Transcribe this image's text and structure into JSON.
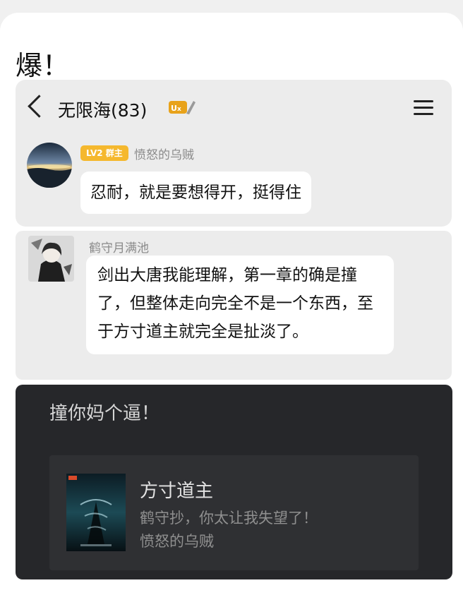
{
  "post": {
    "title": "爆！"
  },
  "chat": {
    "header": {
      "title": "无限海(83)",
      "badge": "vip-badge"
    },
    "messages": [
      {
        "role_badge": "LV2 群主",
        "sender": "愤怒的乌贼",
        "text": "忍耐，就是要想得开，挺得住"
      },
      {
        "sender": "鹤守月满池",
        "text": "剑出大唐我能理解，第一章的确是撞了，但整体走向完全不是一个东西，至于方寸道主就完全是扯淡了。"
      }
    ]
  },
  "reply": {
    "text": "撞你妈个逼！",
    "book": {
      "title": "方寸道主",
      "subtitle": "鹤守抄，你太让我失望了！",
      "author": "愤怒的乌贼"
    }
  },
  "colors": {
    "page_bg": "#ffffff",
    "chat_panel_bg": "#ececec",
    "bubble_bg": "#ffffff",
    "role_badge_bg": "#f5b82e",
    "dark_panel_bg": "#26272a",
    "book_card_bg": "#2f3033"
  }
}
